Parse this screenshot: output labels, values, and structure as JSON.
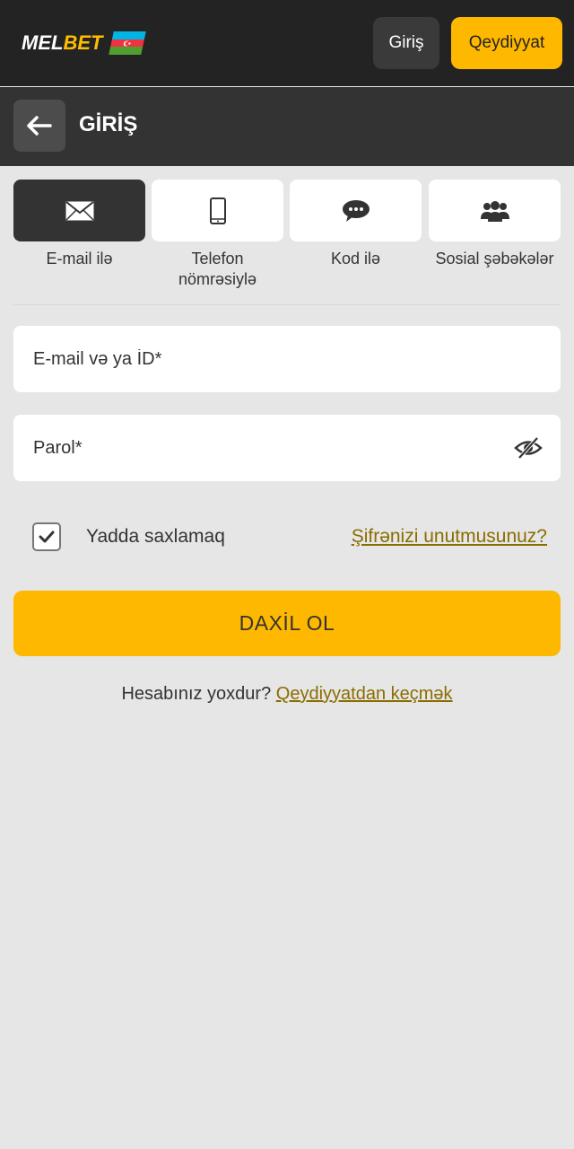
{
  "header": {
    "logo_part1": "MEL",
    "logo_part2": "BET",
    "login_label": "Giriş",
    "register_label": "Qeydiyyat",
    "flag_colors": [
      "#00b5e2",
      "#ef3340",
      "#509e2f"
    ]
  },
  "subheader": {
    "title": "GİRİŞ",
    "back_icon": "arrow-left-icon"
  },
  "tabs": [
    {
      "label": "E-mail ilə",
      "icon": "envelope-icon",
      "active": true
    },
    {
      "label": "Telefon nömrəsiylə",
      "icon": "phone-icon",
      "active": false
    },
    {
      "label": "Kod ilə",
      "icon": "chat-bubble-icon",
      "active": false
    },
    {
      "label": "Sosial şəbəkələr",
      "icon": "users-icon",
      "active": false
    }
  ],
  "form": {
    "email_placeholder": "E-mail və ya İD*",
    "password_placeholder": "Parol*",
    "remember_label": "Yadda saxlamaq",
    "remember_checked": true,
    "forgot_label": "Şifrənizi unutmusunuz?",
    "submit_label": "DAXİL OL"
  },
  "footer": {
    "no_account_text": "Hesabınız yoxdur?",
    "register_link": "Qeydiyyatdan keçmək"
  },
  "colors": {
    "accent": "#ffb800",
    "topbar": "#232323",
    "subheader": "#333333",
    "background": "#e6e6e6",
    "link": "#8a6d00"
  }
}
